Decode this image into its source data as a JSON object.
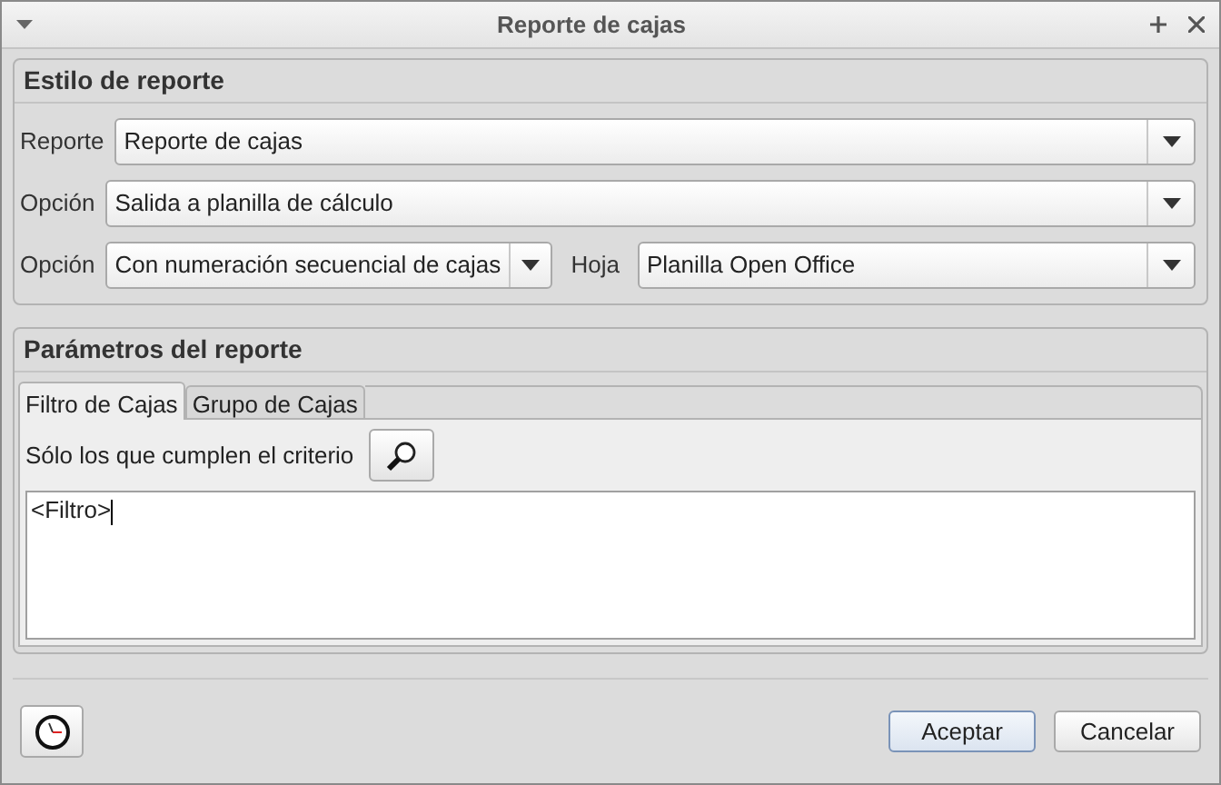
{
  "window": {
    "title": "Reporte de cajas"
  },
  "style_section": {
    "title": "Estilo de reporte",
    "rows": [
      {
        "label": "Reporte",
        "value": "Reporte de cajas"
      },
      {
        "label": "Opción",
        "value": "Salida a planilla de cálculo"
      }
    ],
    "last_row": {
      "label": "Opción",
      "value": "Con numeración secuencial de cajas",
      "sheet_label": "Hoja",
      "sheet_value": "Planilla Open Office"
    }
  },
  "params_section": {
    "title": "Parámetros del reporte",
    "tabs": [
      {
        "label": "Filtro de Cajas",
        "selected": true
      },
      {
        "label": "Grupo de Cajas",
        "selected": false
      }
    ],
    "criteria_label": "Sólo los que cumplen el criterio",
    "filter_text": "<Filtro>"
  },
  "buttons": [
    {
      "label": "Aceptar",
      "default": true
    },
    {
      "label": "Cancelar",
      "default": false
    }
  ]
}
